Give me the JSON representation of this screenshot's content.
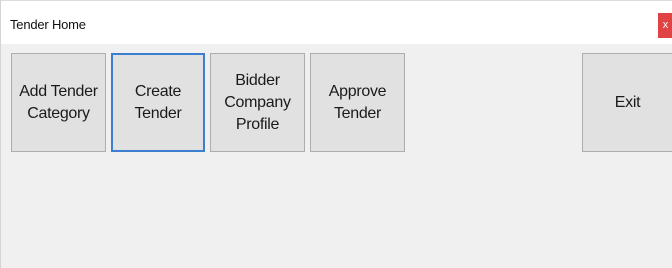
{
  "window": {
    "title": "Tender Home",
    "close_label": "x"
  },
  "buttons": {
    "add_tender_category": "Add Tender\nCategory",
    "create_tender": "Create\nTender",
    "bidder_company_profile": "Bidder\nCompany\nProfile",
    "approve_tender": "Approve\nTender",
    "exit": "Exit"
  },
  "colors": {
    "close_button": "#e04343",
    "focus_border": "#3c7fce",
    "button_face": "#e1e1e1",
    "window_background": "#f0f0f0"
  }
}
